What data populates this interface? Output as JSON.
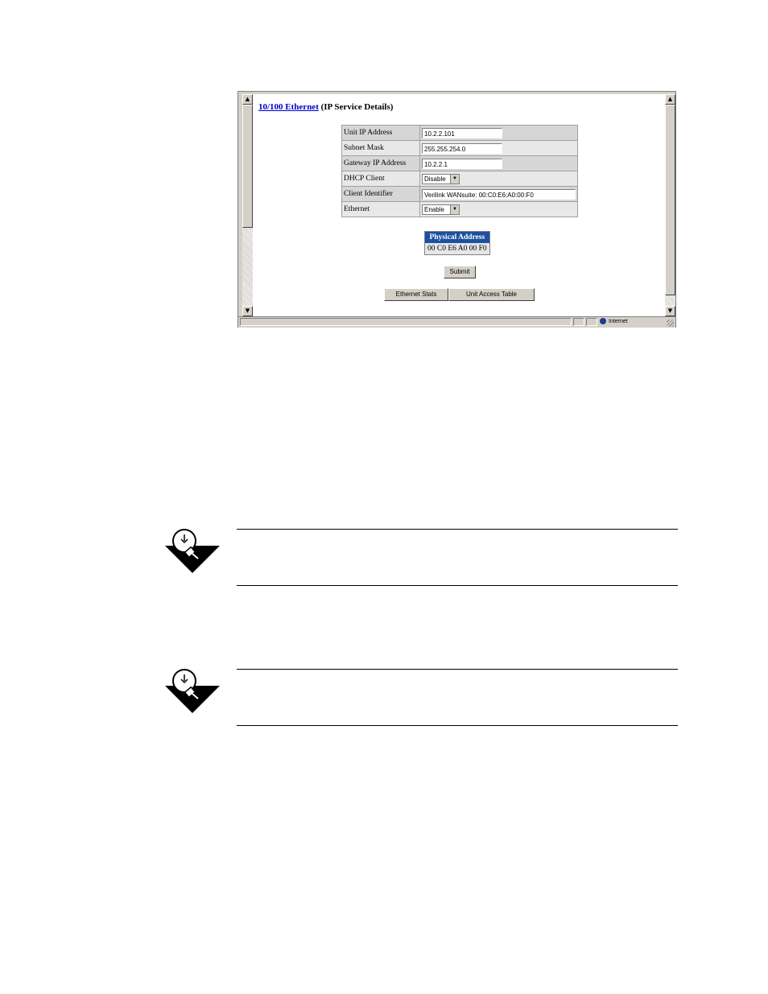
{
  "breadcrumb": {
    "link": "10/100 Ethernet",
    "suffix": "(IP Service Details)"
  },
  "form": {
    "rows": [
      {
        "label": "Unit IP Address",
        "value": "10.2.2.101",
        "type": "text"
      },
      {
        "label": "Subnet Mask",
        "value": "255.255.254.0",
        "type": "text"
      },
      {
        "label": "Gateway IP Address",
        "value": "10.2.2.1",
        "type": "text"
      },
      {
        "label": "DHCP Client",
        "value": "Disable",
        "type": "select"
      },
      {
        "label": "Client Identifier",
        "value": "Verilink WANsuite: 00:C0:E6:A0:00:F0",
        "type": "text"
      },
      {
        "label": "Ethernet",
        "value": "Enable",
        "type": "select"
      }
    ]
  },
  "physical": {
    "header": "Physical Address",
    "value": "00 C0 E6 A0 00 F0"
  },
  "buttons": {
    "submit": "Submit",
    "ethernet_stats": "Ethernet Stats",
    "unit_access_table": "Unit Access Table"
  },
  "status_bar": {
    "zone": "Internet"
  },
  "colors": {
    "link": "#0000cc",
    "header_bg": "#1c50a0"
  },
  "icons": [
    "lightbulb-note-icon",
    "scroll-up-icon",
    "scroll-down-icon",
    "internet-zone-icon"
  ]
}
